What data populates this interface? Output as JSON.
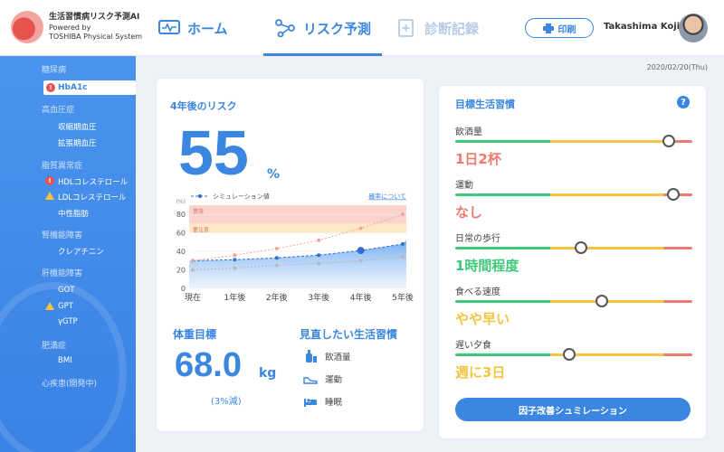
{
  "brand": {
    "title": "生活習慣病リスク予測AI",
    "powered1": "Powered by",
    "powered2": "TOSHIBA Physical System"
  },
  "nav": {
    "home": "ホーム",
    "risk": "リスク予測",
    "record": "診断記録"
  },
  "print_label": "印刷",
  "user_name": "Takashima Koji",
  "date": "2020/02/20(Thu)",
  "sidebar": {
    "cat_diabetes": "糖尿病",
    "item_hba1c": "HbA1c",
    "cat_hypertension": "高血圧症",
    "item_systolic": "収縮期血圧",
    "item_diastolic": "拡張期血圧",
    "cat_lipid": "脂質異常症",
    "item_hdl": "HDLコレステロール",
    "item_ldl": "LDLコレステロール",
    "item_tg": "中性脂肪",
    "cat_kidney": "腎機能障害",
    "item_creatinine": "クレアチニン",
    "cat_liver": "肝機能障害",
    "item_got": "GOT",
    "item_gpt": "GPT",
    "item_ggtp": "γGTP",
    "cat_obesity": "肥満症",
    "item_bmi": "BMI",
    "cat_heart": "心疾患(開発中)"
  },
  "risk": {
    "title": "4年後のリスク",
    "value": "55",
    "unit": "%"
  },
  "chart_data": {
    "type": "line",
    "legend": "シミュレーション値",
    "link": "確率について",
    "ylabel": "(%)",
    "ylim": [
      0,
      90
    ],
    "yticks": [
      "0",
      "20",
      "40",
      "60",
      "80"
    ],
    "categories": [
      "現在",
      "1年後",
      "2年後",
      "3年後",
      "4年後",
      "5年後"
    ],
    "bands": [
      {
        "label": "異常",
        "from": 70,
        "to": 90,
        "color": "#fbd3cc"
      },
      {
        "label": "要注意",
        "from": 60,
        "to": 70,
        "color": "#fde9c4"
      }
    ],
    "series": [
      {
        "name": "シミュレーション値",
        "values": [
          30,
          31,
          33,
          36,
          41,
          48
        ]
      },
      {
        "values": [
          30,
          36,
          43,
          52,
          65,
          80
        ]
      },
      {
        "values": [
          20,
          22,
          25,
          27,
          30,
          34
        ]
      }
    ]
  },
  "weight": {
    "title": "体重目標",
    "value": "68.0",
    "unit": "kg",
    "note": "(3%減)"
  },
  "habits": {
    "title": "見直したい生活習慣",
    "items": [
      "飲酒量",
      "運動",
      "睡眠"
    ]
  },
  "goals": {
    "title": "目標生活習慣",
    "help": "?",
    "rows": [
      {
        "label": "飲酒量",
        "value": "1日2杯",
        "level": 0.9,
        "color": "#ec7b6f"
      },
      {
        "label": "運動",
        "value": "なし",
        "level": 0.92,
        "color": "#ec7b6f"
      },
      {
        "label": "日常の歩行",
        "value": "1時間程度",
        "level": 0.53,
        "color": "#3ec87a"
      },
      {
        "label": "食べる速度",
        "value": "やや早い",
        "level": 0.62,
        "color": "#f4c542"
      },
      {
        "label": "遅い夕食",
        "value": "週に3日",
        "level": 0.48,
        "color": "#f4c542"
      }
    ]
  },
  "sim_button": "因子改善シュミレーション"
}
